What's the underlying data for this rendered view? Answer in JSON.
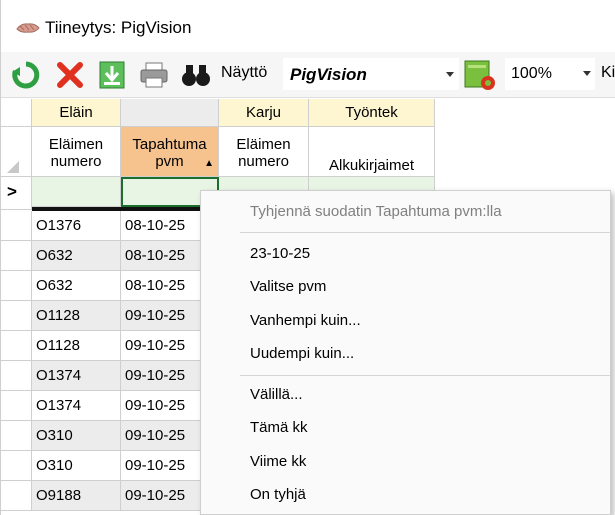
{
  "window": {
    "title": "Tiineytys: PigVision"
  },
  "toolbar": {
    "view_label": "Näyttö",
    "view_value": "PigVision",
    "zoom_value": "100%",
    "trailing_text": "Ki"
  },
  "grid": {
    "groups": [
      "Eläin",
      "",
      "Karju",
      "Työntek"
    ],
    "headers": [
      {
        "line1": "Eläimen",
        "line2": "numero"
      },
      {
        "line1": "Tapahtuma",
        "line2": "pvm"
      },
      {
        "line1": "Eläimen",
        "line2": "numero"
      },
      {
        "line1": "",
        "line2": "Alkukirjaimet"
      }
    ],
    "row_indicator": ">",
    "rows": [
      {
        "animal": "O1376",
        "date": "08-10-25"
      },
      {
        "animal": "O632",
        "date": "08-10-25"
      },
      {
        "animal": "O632",
        "date": "08-10-25"
      },
      {
        "animal": "O1128",
        "date": "09-10-25"
      },
      {
        "animal": "O1128",
        "date": "09-10-25"
      },
      {
        "animal": "O1374",
        "date": "09-10-25"
      },
      {
        "animal": "O1374",
        "date": "09-10-25"
      },
      {
        "animal": "O310",
        "date": "09-10-25"
      },
      {
        "animal": "O310",
        "date": "09-10-25"
      },
      {
        "animal": "O9188",
        "date": "09-10-25"
      }
    ]
  },
  "context_menu": {
    "clear_filter": "Tyhjennä suodatin Tapahtuma pvm:lla",
    "items_a": [
      "23-10-25",
      "Valitse pvm",
      "Vanhempi kuin...",
      "Uudempi kuin..."
    ],
    "items_b": [
      "Välillä...",
      "Tämä kk",
      "Viime kk",
      "On tyhjä"
    ]
  }
}
